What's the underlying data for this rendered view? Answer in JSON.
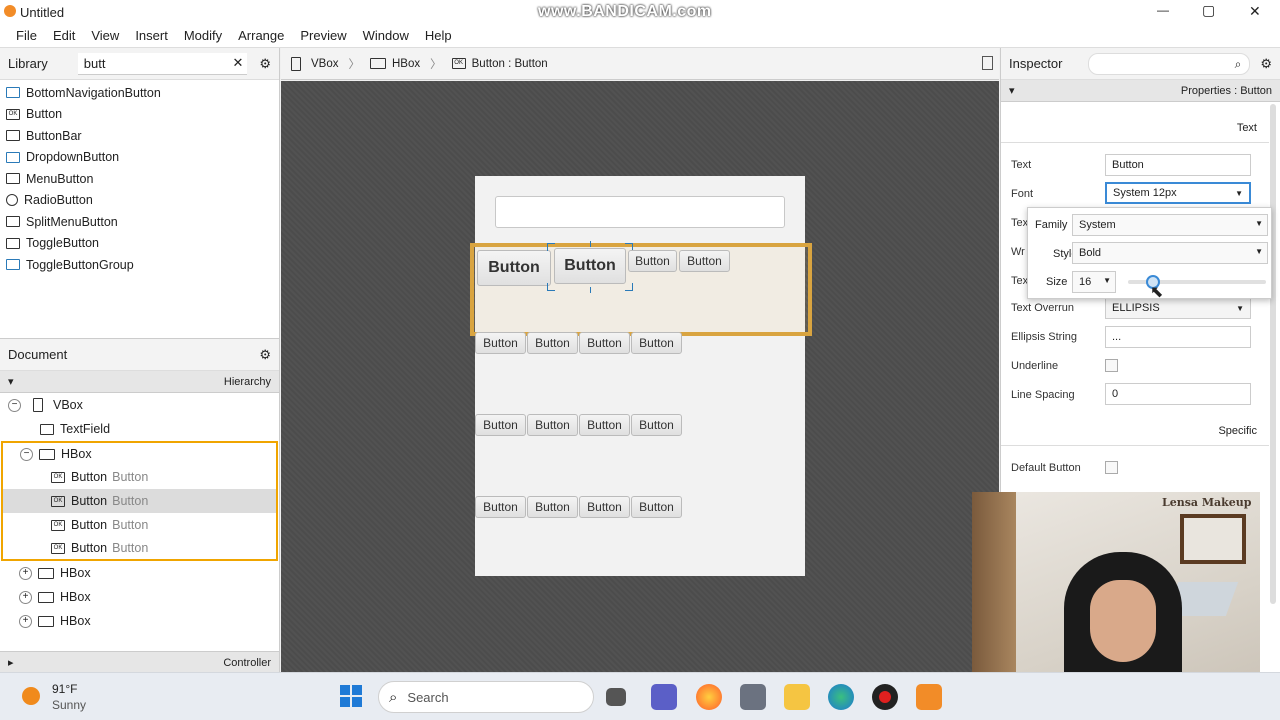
{
  "window": {
    "title": "Untitled",
    "watermark": "www.BANDICAM.com",
    "min": "—",
    "max": "▢",
    "close": "✕"
  },
  "menu": [
    "File",
    "Edit",
    "View",
    "Insert",
    "Modify",
    "Arrange",
    "Preview",
    "Window",
    "Help"
  ],
  "library": {
    "title": "Library",
    "search": "butt",
    "items": [
      "BottomNavigationButton",
      "Button",
      "ButtonBar",
      "DropdownButton",
      "MenuButton",
      "RadioButton",
      "SplitMenuButton",
      "ToggleButton",
      "ToggleButtonGroup"
    ]
  },
  "breadcrumb": [
    "VBox",
    "HBox",
    "Button : Button"
  ],
  "document": {
    "title": "Document",
    "hierarchy": "Hierarchy",
    "controller": "Controller",
    "tree": [
      {
        "label": "VBox",
        "sub": ""
      },
      {
        "label": "TextField",
        "sub": ""
      },
      {
        "label": "HBox",
        "sub": ""
      },
      {
        "label": "Button",
        "sub": "Button"
      },
      {
        "label": "Button",
        "sub": "Button"
      },
      {
        "label": "Button",
        "sub": "Button"
      },
      {
        "label": "Button",
        "sub": "Button"
      },
      {
        "label": "HBox",
        "sub": ""
      },
      {
        "label": "HBox",
        "sub": ""
      },
      {
        "label": "HBox",
        "sub": ""
      }
    ]
  },
  "canvas": {
    "row1": [
      "Button",
      "Button",
      "Button",
      "Button"
    ],
    "row2": [
      "Button",
      "Button",
      "Button",
      "Button"
    ],
    "row3": [
      "Button",
      "Button",
      "Button",
      "Button"
    ],
    "row4": [
      "Button",
      "Button",
      "Button",
      "Button"
    ]
  },
  "inspector": {
    "title": "Inspector",
    "properties": "Properties : Button",
    "section_text": "Text",
    "section_specific": "Specific",
    "text_label": "Text",
    "text_value": "Button",
    "font_label": "Font",
    "font_value": "System 12px",
    "text_overrun_label": "Text Overrun",
    "text_overrun_value": "ELLIPSIS",
    "ellipsis_label": "Ellipsis String",
    "ellipsis_value": "...",
    "underline_label": "Underline",
    "line_spacing_label": "Line Spacing",
    "line_spacing_value": "0",
    "default_button_label": "Default Button",
    "partial_1": "Tex",
    "partial_2": "Wr",
    "partial_3": "Tex"
  },
  "font_popup": {
    "family_label": "Family",
    "family_value": "System",
    "style_label": "Style",
    "style_value": "Bold",
    "size_label": "Size",
    "size_value": "16"
  },
  "webcam": {
    "sign": "Lensa Makeup"
  },
  "taskbar": {
    "temp": "91°F",
    "weather": "Sunny",
    "search": "Search"
  },
  "colors": {
    "selection": "#f0a500",
    "canvas_bg": "#4c4c4c",
    "accent": "#2a7ab8"
  }
}
